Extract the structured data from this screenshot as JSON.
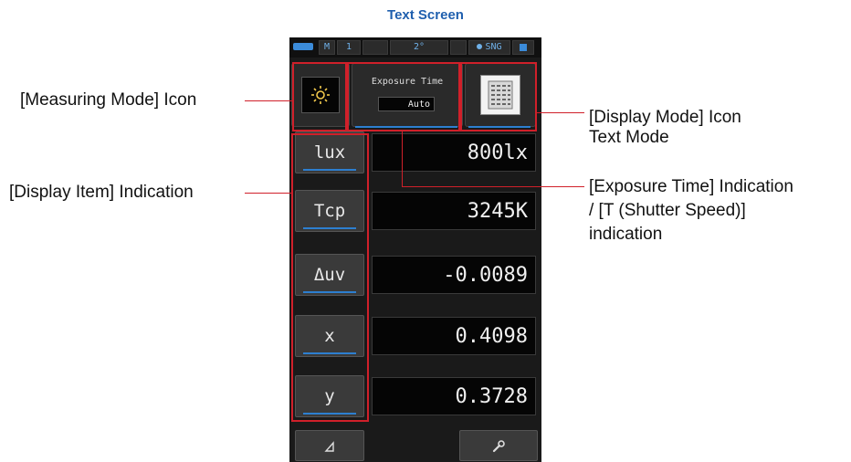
{
  "title": "Text Screen",
  "status_bar": {
    "mode": "M",
    "channel": "1",
    "angle": "2°",
    "sng": "SNG"
  },
  "measuring_mode_icon": "sun-icon",
  "exposure": {
    "label": "Exposure Time",
    "value": "Auto"
  },
  "display_mode_icon": "text-mode-icon",
  "items": [
    {
      "name": "lux",
      "value": "800lx"
    },
    {
      "name": "Tcp",
      "value": "3245K"
    },
    {
      "name": "Δuv",
      "value": "-0.0089"
    },
    {
      "name": "x",
      "value": "0.4098"
    },
    {
      "name": "y",
      "value": "0.3728"
    }
  ],
  "bottom_bar": {
    "left_icon": "triangle-icon",
    "right_icon": "wrench-icon"
  },
  "annotations": {
    "measuring_mode": "[Measuring Mode] Icon",
    "display_item": "[Display Item] Indication",
    "display_mode_line1": "[Display Mode] Icon",
    "display_mode_line2": "Text Mode",
    "exposure_line1": "[Exposure Time] Indication",
    "exposure_line2": "/ [T (Shutter Speed)]",
    "exposure_line3": "indication"
  },
  "colors": {
    "accent": "#2d7fd0",
    "annotation_red": "#d0202a",
    "title_blue": "#1f5fae"
  }
}
